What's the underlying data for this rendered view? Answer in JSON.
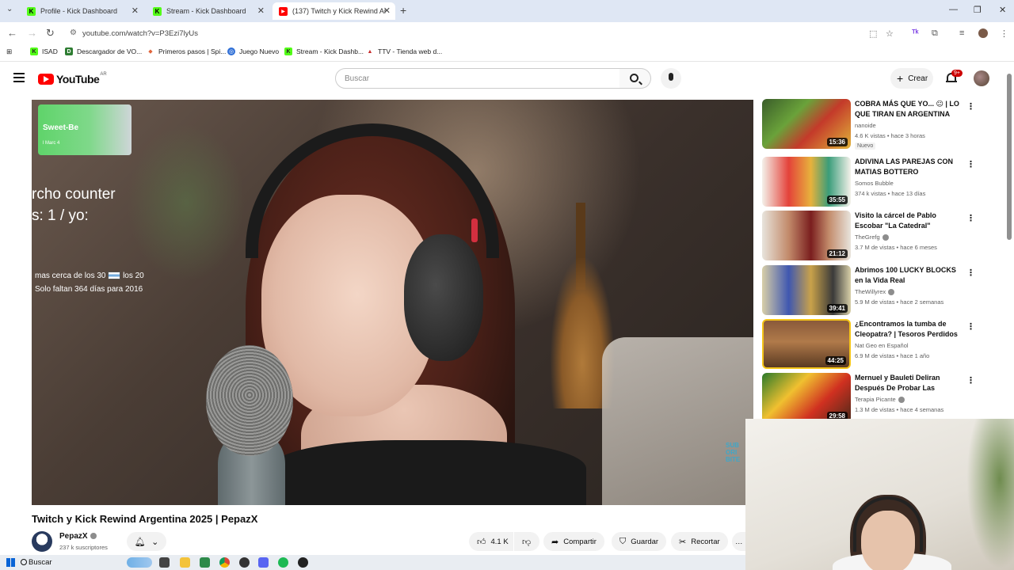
{
  "browser": {
    "tabs": [
      {
        "title": "Profile - Kick Dashboard",
        "active": false
      },
      {
        "title": "Stream - Kick Dashboard",
        "active": false
      },
      {
        "title": "(137) Twitch y Kick Rewind Arg",
        "active": true
      }
    ],
    "url": "youtube.com/watch?v=P3Ezi7lyUs",
    "bookmarks": [
      "ISAD",
      "Descargador de VO...",
      "Primeros pasos | Spi...",
      "Juego Nuevo",
      "Stream - Kick Dashb...",
      "TTV - Tienda web d..."
    ]
  },
  "youtube": {
    "logo_text": "YouTube",
    "region": "AR",
    "search_placeholder": "Buscar",
    "create_label": "Crear",
    "notifications_badge": "9+"
  },
  "video": {
    "overlay": {
      "badge_title": "Sweet-Be",
      "badge_sub": "l Marc 4",
      "counter_line1": "rcho counter",
      "counter_line2": "s: 1 / yo:",
      "note_line1_a": "mas cerca de los 30",
      "note_line1_b": "los 20",
      "note_line2": "Solo faltan 364 días para 2016",
      "corner_text": "SUB ORI BITE"
    },
    "title": "Twitch y Kick Rewind Argentina 2025 | PepazX",
    "channel": "PepazX",
    "subscribers": "237 k suscriptores",
    "likes": "4.1 K",
    "share_label": "Compartir",
    "save_label": "Guardar",
    "clip_label": "Recortar"
  },
  "recommendations": [
    {
      "title": "COBRA MÁS QUE YO... 😐 | LO QUE TIRAN EN ARGENTINA",
      "channel": "nanoide",
      "meta": "4.6 K vistas • hace 3 horas",
      "duration": "15:36",
      "badge": "Nuevo",
      "verified": false
    },
    {
      "title": "ADIVINA LAS PAREJAS CON MATIAS BOTTERO",
      "channel": "Somos Bubble",
      "meta": "374 k vistas • hace 13 días",
      "duration": "35:55",
      "badge": "",
      "verified": false
    },
    {
      "title": "Visito la cárcel de Pablo Escobar \"La Catedral\"",
      "channel": "TheGrefg",
      "meta": "3.7 M de vistas • hace 6 meses",
      "duration": "21:12",
      "badge": "",
      "verified": true
    },
    {
      "title": "Abrimos 100 LUCKY BLOCKS en la Vida Real",
      "channel": "TheWillyrex",
      "meta": "5.9 M de vistas • hace 2 semanas",
      "duration": "39:41",
      "badge": "",
      "verified": true
    },
    {
      "title": "¿Encontramos la tumba de Cleopatra? | Tesoros Perdidos ...",
      "channel": "Nat Geo en Español",
      "meta": "6.9 M de vistas • hace 1 año",
      "duration": "44:25",
      "badge": "",
      "verified": false
    },
    {
      "title": "Mernuel y Bauleti Deliran Después De Probar Las Salsas...",
      "channel": "Terapia Picante",
      "meta": "1.3 M de vistas • hace 4 semanas",
      "duration": "29:58",
      "badge": "",
      "verified": true
    }
  ],
  "taskbar": {
    "search_label": "Buscar"
  },
  "colors": {
    "youtube_red": "#ff0000",
    "kick_green": "#53fc18",
    "badge_red": "#cc0000"
  }
}
